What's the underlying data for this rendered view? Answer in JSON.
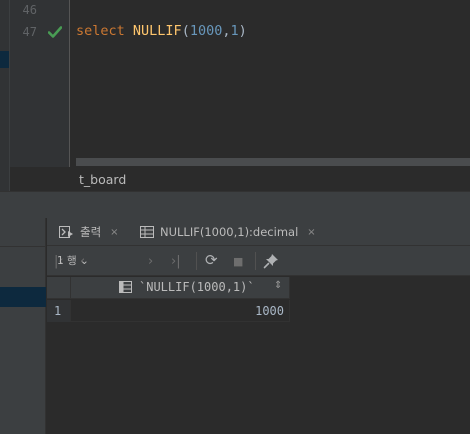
{
  "editor": {
    "line_numbers": [
      "46",
      "47"
    ],
    "code": {
      "keyword": "select",
      "function": "NULLIF",
      "open": "(",
      "arg1": "1000",
      "comma": ",",
      "arg2": "1",
      "close": ")"
    }
  },
  "breadcrumb": {
    "label": "t_board"
  },
  "tabs": {
    "output": {
      "label": "출력",
      "close": "×"
    },
    "result": {
      "label": "NULLIF(1000,1):decimal",
      "close": "×"
    }
  },
  "toolbar": {
    "first_glyph": "|‹",
    "prev_glyph": "‹",
    "page_label": "1 행",
    "page_dropdown_glyph": "⌄",
    "next_glyph": "›",
    "last_glyph": "›|",
    "refresh_glyph": "⟳",
    "stop_glyph": "■",
    "pin_glyph": "📌"
  },
  "grid": {
    "column_header": "`NULLIF(1000,1)`",
    "sort_glyph": "⇕",
    "rows": [
      {
        "num": "1",
        "value": "1000"
      }
    ]
  },
  "colors": {
    "background": "#2b2b2b",
    "panel": "#3c3f41",
    "keyword": "#cc7832",
    "function": "#ffc66d",
    "number": "#6897bb",
    "check": "#499c54",
    "selection": "#0d293e"
  }
}
